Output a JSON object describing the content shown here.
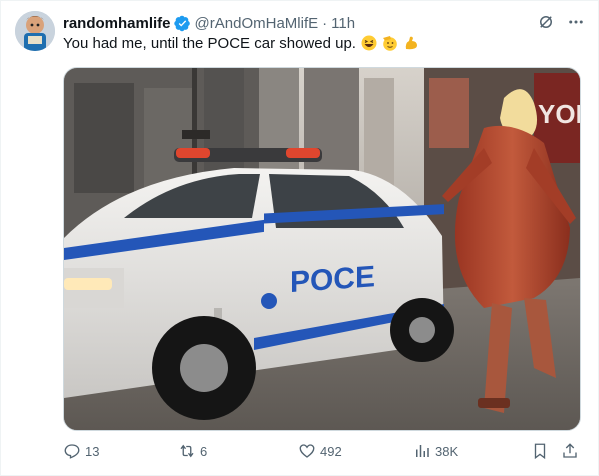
{
  "tweet": {
    "display_name": "randomhamlife",
    "handle": "@rAndOmHaMlifE",
    "separator": "·",
    "time": "11h",
    "text": "You had me, until the POCE car showed up.",
    "emojis": [
      "grinning-squinting-face",
      "saluting-face",
      "flexed-biceps"
    ]
  },
  "media": {
    "car_lettering": "POCE",
    "sign_lettering": "YORK"
  },
  "actions": {
    "replies": "13",
    "retweets": "6",
    "likes": "492",
    "views": "38K"
  },
  "colors": {
    "verified": "#1d9bf0",
    "muted_text": "#536471",
    "police_blue": "#2456b8",
    "coat": "#b8462e"
  },
  "icons": [
    "verified-badge-icon",
    "grok-icon",
    "more-icon",
    "reply-icon",
    "retweet-icon",
    "like-icon",
    "views-icon",
    "bookmark-icon",
    "share-icon"
  ]
}
